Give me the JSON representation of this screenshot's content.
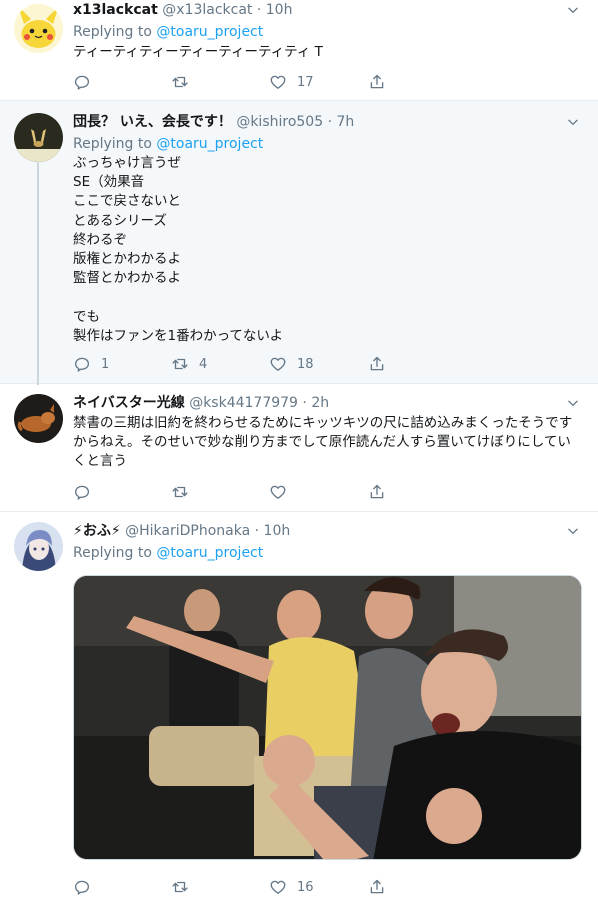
{
  "replying_label": "Replying to",
  "tweets": [
    {
      "name": "x13lackcat",
      "handle": "@x13lackcat",
      "time": "· 10h",
      "reply_to": "@toaru_project",
      "text": "ティーティティーティーティーティティ T",
      "replies": "",
      "retweets": "",
      "likes": "17"
    },
    {
      "name": "団長？ いえ、会長です！",
      "handle": "@kishiro505",
      "time": "· 7h",
      "reply_to": "@toaru_project",
      "text": "ぶっちゃけ言うぜ\nSE（効果音\nここで戻さないと\nとあるシリーズ\n終わるぞ\n版権とかわかるよ\n監督とかわかるよ\n\nでも\n製作はファンを1番わかってないよ",
      "replies": "1",
      "retweets": "4",
      "likes": "18"
    },
    {
      "name": "ネイバスター光線",
      "handle": "@ksk44177979",
      "time": "· 2h",
      "text": "禁書の三期は旧約を終わらせるためにキッツキツの尺に詰め込みまくったそうですからねえ。そのせいで妙な削り方までして原作読んだ人すら置いてけぼりにしていくと言う",
      "replies": "",
      "retweets": "",
      "likes": ""
    },
    {
      "name": "⚡おふ⚡",
      "handle": "@HikariDPhonaka",
      "time": "· 10h",
      "reply_to": "@toaru_project",
      "replies": "",
      "retweets": "",
      "likes": "16"
    }
  ],
  "icons": {
    "reply": "reply-icon",
    "retweet": "retweet-icon",
    "like": "heart-icon",
    "share": "share-icon",
    "caret": "chevron-down-icon"
  },
  "colors": {
    "link": "#1da1f2",
    "muted": "#657786",
    "highlight_bg": "#f5f8fa",
    "divider": "#e6ecf0"
  }
}
